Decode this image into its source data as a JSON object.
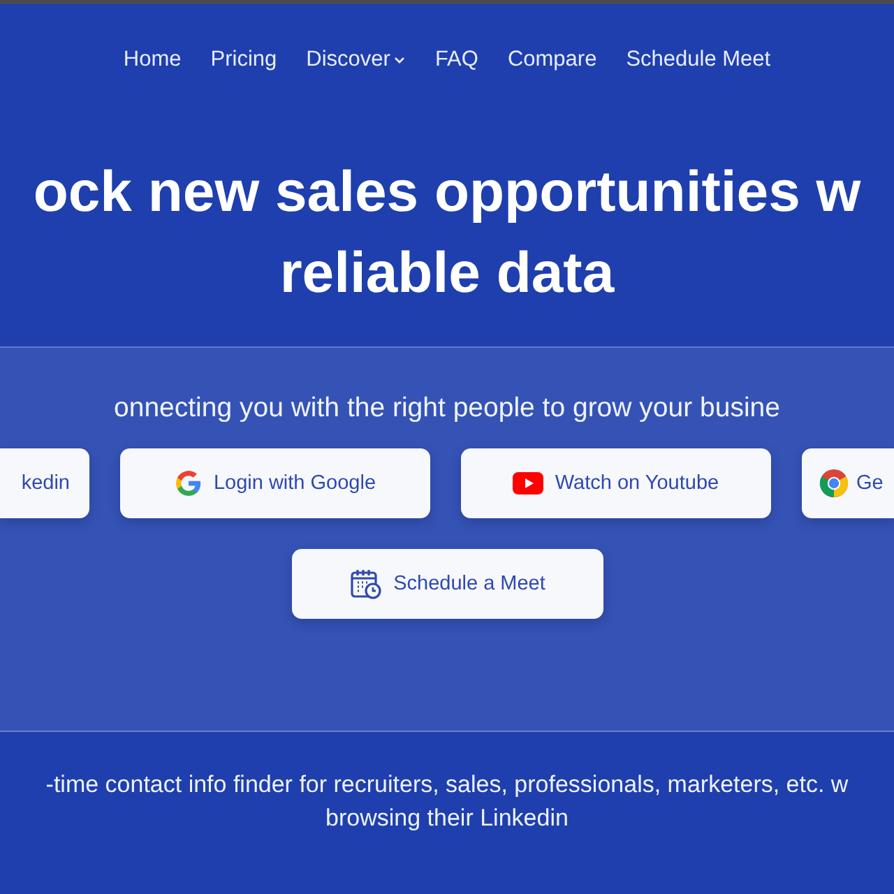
{
  "nav": [
    {
      "label": "Home",
      "kind": "link"
    },
    {
      "label": "Pricing",
      "kind": "link"
    },
    {
      "label": "Discover",
      "kind": "dropdown"
    },
    {
      "label": "FAQ",
      "kind": "link"
    },
    {
      "label": "Compare",
      "kind": "link"
    },
    {
      "label": "Schedule Meet",
      "kind": "link"
    }
  ],
  "headline": [
    "ock new sales opportunities w",
    "reliable data"
  ],
  "panel": {
    "subtitle": "onnecting you with the right people to grow your busine",
    "buttons": [
      {
        "label": "kedin",
        "kind": "plain"
      },
      {
        "label": "Login with Google",
        "kind": "google"
      },
      {
        "label": "Watch on Youtube",
        "kind": "youtube"
      },
      {
        "label": "Ge",
        "kind": "chrome"
      }
    ],
    "schedule_button": {
      "label": "Schedule a Meet"
    }
  },
  "description": [
    "-time contact info finder for recruiters, sales, professionals, marketers, etc. w",
    "browsing their Linkedin"
  ]
}
